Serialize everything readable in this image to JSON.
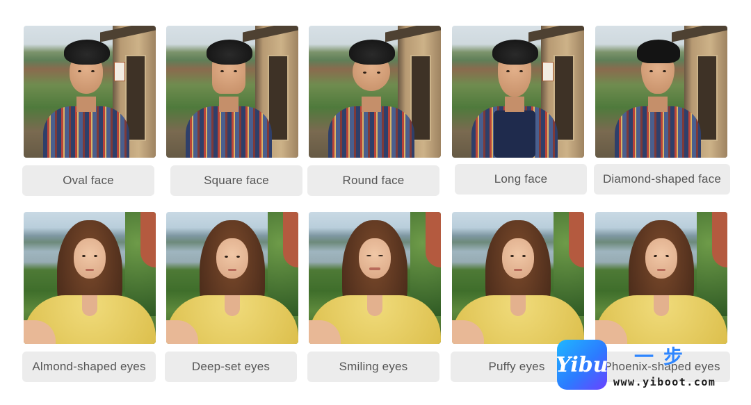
{
  "face_shapes": [
    {
      "label": "Oval face"
    },
    {
      "label": "Square face"
    },
    {
      "label": "Round face"
    },
    {
      "label": "Long face"
    },
    {
      "label": "Diamond-shaped face"
    }
  ],
  "eye_shapes": [
    {
      "label": "Almond-shaped eyes"
    },
    {
      "label": "Deep-set eyes"
    },
    {
      "label": "Smiling eyes"
    },
    {
      "label": "Puffy eyes"
    },
    {
      "label": "Phoenix-shaped eyes"
    }
  ],
  "watermark": {
    "logo_text": "Yibu",
    "chinese_text": "一步",
    "url": "www.yiboot.com"
  },
  "colors": {
    "label_bg": "#ececec",
    "label_text": "#555555",
    "brand_blue": "#2e86ff"
  }
}
